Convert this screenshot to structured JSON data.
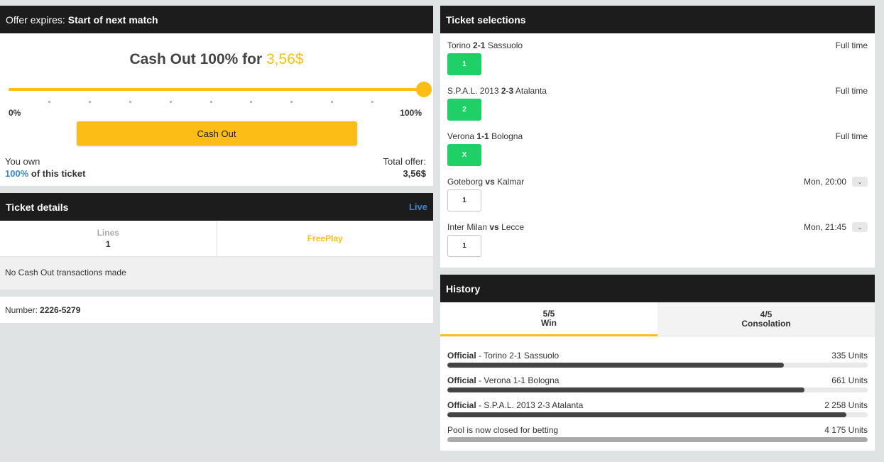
{
  "offer": {
    "label": "Offer expires:",
    "value": "Start of next match",
    "title_prefix": "Cash Out 100% for",
    "amount": "3,56$",
    "slider_value": 1.0,
    "slider_min": "0%",
    "slider_max": "100%",
    "button": "Cash Out",
    "you_own": "You own",
    "own_pct": "100%",
    "own_suffix": "of this ticket",
    "total_label": "Total offer:",
    "total_value": "3,56$"
  },
  "ticket_details": {
    "title": "Ticket details",
    "live": "Live",
    "lines_label": "Lines",
    "lines_value": "1",
    "freeplay": "FreePlay",
    "no_cashout": "No Cash Out transactions made"
  },
  "number": {
    "label": "Number:",
    "value": "2226-5279"
  },
  "selections": {
    "title": "Ticket selections",
    "items": [
      {
        "home": "Torino",
        "score": "2-1",
        "away": "Sassuolo",
        "when": "Full time",
        "pick": "1",
        "state": "win"
      },
      {
        "home": "S.P.A.L. 2013",
        "score": "2-3",
        "away": "Atalanta",
        "when": "Full time",
        "pick": "2",
        "state": "win"
      },
      {
        "home": "Verona",
        "score": "1-1",
        "away": "Bologna",
        "when": "Full time",
        "pick": "X",
        "state": "win"
      },
      {
        "home": "Goteborg",
        "score": "vs",
        "away": "Kalmar",
        "when": "Mon, 20:00",
        "pick": "1",
        "state": "open"
      },
      {
        "home": "Inter Milan",
        "score": "vs",
        "away": "Lecce",
        "when": "Mon, 21:45",
        "pick": "1",
        "state": "open"
      }
    ]
  },
  "history": {
    "title": "History",
    "tabs": [
      {
        "top": "5/5",
        "bottom": "Win"
      },
      {
        "top": "4/5",
        "bottom": "Consolation"
      }
    ],
    "rows": [
      {
        "prefix": "Official",
        "text": " - Torino 2-1 Sassuolo",
        "units": "335 Units",
        "fill": 0.8
      },
      {
        "prefix": "Official",
        "text": " - Verona 1-1 Bologna",
        "units": "661 Units",
        "fill": 0.85
      },
      {
        "prefix": "Official",
        "text": " - S.P.A.L. 2013 2-3 Atalanta",
        "units": "2 258 Units",
        "fill": 0.95
      },
      {
        "prefix": "",
        "text": "Pool is now closed for betting",
        "units": "4 175 Units",
        "fill": 1.0
      }
    ]
  },
  "colors": {
    "accent": "#fbbd16",
    "win": "#1ed066",
    "link": "#3a86d1",
    "header": "#1c1c1c"
  }
}
